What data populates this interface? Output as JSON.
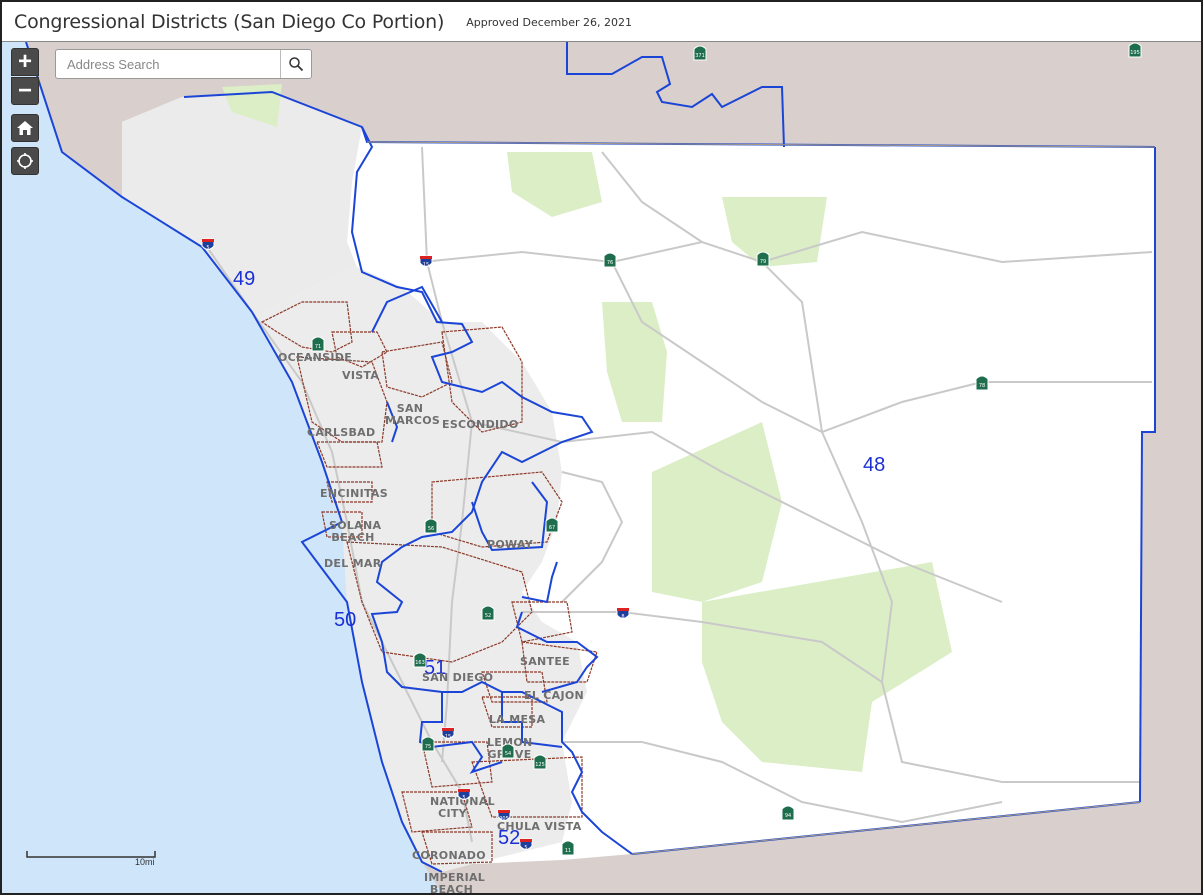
{
  "header": {
    "title": "Congressional Districts (San Diego Co Portion)",
    "subtitle": "Approved December 26, 2021"
  },
  "controls": {
    "zoom_in_label": "+",
    "zoom_out_label": "−"
  },
  "search": {
    "placeholder": "Address Search"
  },
  "districts": [
    "49",
    "48",
    "50",
    "51",
    "52"
  ],
  "cities": [
    "OCEANSIDE",
    "VISTA",
    "SAN MARCOS",
    "ESCONDIDO",
    "CARLSBAD",
    "ENCINITAS",
    "SOLANA BEACH",
    "DEL MAR",
    "POWAY",
    "SANTEE",
    "SAN DIEGO",
    "EL CAJON",
    "LA MESA",
    "LEMON GROVE",
    "NATIONAL CITY",
    "CHULA VISTA",
    "CORONADO",
    "IMPERIAL BEACH"
  ],
  "shields": [
    "371",
    "195",
    "5",
    "15",
    "76",
    "79",
    "78",
    "71",
    "56",
    "67",
    "8",
    "52",
    "163",
    "15",
    "5",
    "125",
    "54",
    "94",
    "905",
    "5",
    "11",
    "75",
    "94"
  ],
  "scale": {
    "label": "10mi"
  },
  "colors": {
    "district_boundary": "#1b45d6",
    "city_boundary": "#8b3a2a",
    "ocean": "#cfe5fa",
    "outside_land": "#d9cfcc",
    "county_fill": "#ffffff",
    "urban_fill": "#e9e9e9",
    "parks": "#dbeec6",
    "interstate_shield": "#1f3f9c",
    "state_shield": "#1e6e4e"
  }
}
